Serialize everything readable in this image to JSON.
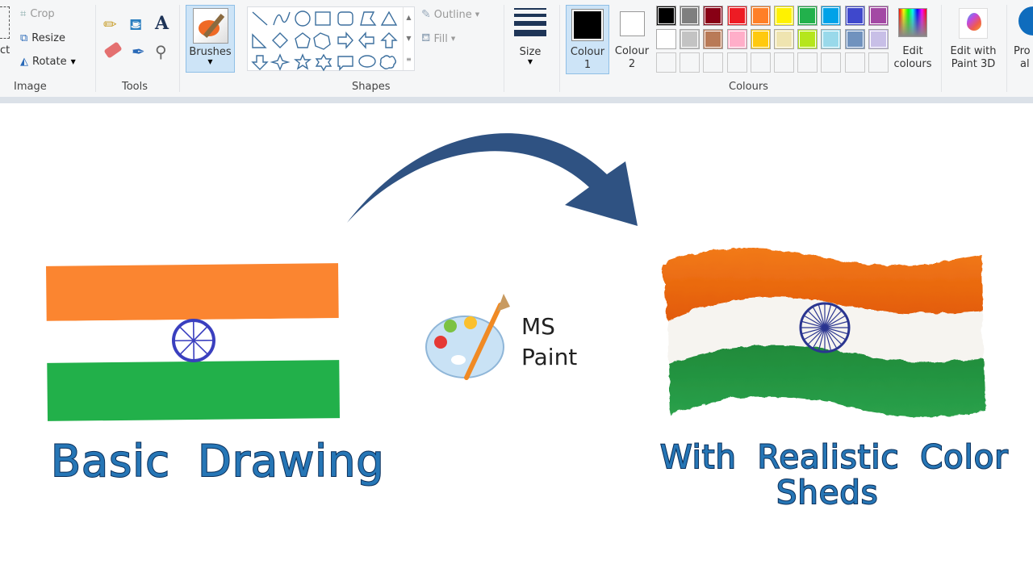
{
  "ribbon": {
    "image": {
      "select_fragment": "ct",
      "crop": "Crop",
      "resize": "Resize",
      "rotate": "Rotate",
      "group": "Image"
    },
    "tools": {
      "group": "Tools",
      "items": [
        "pencil-icon",
        "fill-icon",
        "text-icon",
        "eraser-icon",
        "color-picker-icon",
        "magnifier-icon"
      ]
    },
    "brushes": {
      "label": "Brushes"
    },
    "shapes": {
      "group": "Shapes",
      "outline": "Outline",
      "fill": "Fill"
    },
    "size": {
      "label": "Size"
    },
    "colours": {
      "group": "Colours",
      "colour1": "Colour",
      "colour1_num": "1",
      "colour2": "Colour",
      "colour2_num": "2",
      "edit1": "Edit",
      "edit2": "colours",
      "row1": [
        "#000000",
        "#7f7f7f",
        "#880015",
        "#ed1c24",
        "#ff7f27",
        "#fff200",
        "#22b14c",
        "#00a2e8",
        "#3f48cc",
        "#a349a4"
      ],
      "row2": [
        "#ffffff",
        "#c3c3c3",
        "#b97a57",
        "#ffaec9",
        "#ffc90e",
        "#efe4b0",
        "#b5e61d",
        "#99d9ea",
        "#7092be",
        "#c8bfe7"
      ],
      "primary": "#000000",
      "secondary": "#ffffff"
    },
    "paint3d": {
      "line1": "Edit with",
      "line2": "Paint 3D"
    },
    "product": {
      "line1": "Pro",
      "line2": "al"
    }
  },
  "canvas": {
    "left_caption": "Basic Drawing",
    "right_caption_line1": "With Realistic Color",
    "right_caption_line2": "Sheds",
    "logo_line1": "MS",
    "logo_line2": "Paint",
    "flag_colors": {
      "saffron": "#fb8530",
      "white": "#ffffff",
      "green": "#22b04a",
      "chakra": "#3a3fbf"
    },
    "arrow_color": "#2f5282"
  }
}
